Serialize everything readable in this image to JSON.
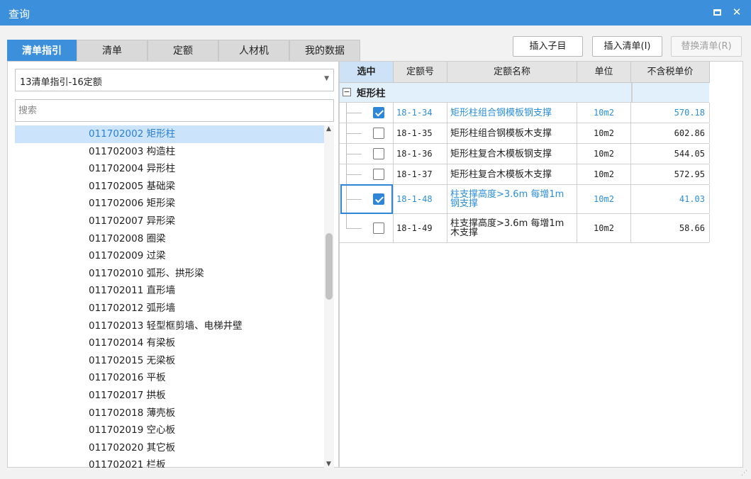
{
  "window": {
    "title": "查询"
  },
  "tabs": [
    {
      "label": "清单指引",
      "active": true
    },
    {
      "label": "清单",
      "active": false
    },
    {
      "label": "定额",
      "active": false
    },
    {
      "label": "人材机",
      "active": false
    },
    {
      "label": "我的数据",
      "active": false
    }
  ],
  "toolbar": {
    "insert_child_label": "插入子目",
    "insert_list_label": "插入清单(I)",
    "replace_list_label": "替换清单(R)"
  },
  "left": {
    "combo_value": "13清单指引-16定额",
    "search_placeholder": "搜索",
    "items": [
      {
        "label": "011702002  矩形柱",
        "selected": true
      },
      {
        "label": "011702003  构造柱"
      },
      {
        "label": "011702004  异形柱"
      },
      {
        "label": "011702005  基础梁"
      },
      {
        "label": "011702006  矩形梁"
      },
      {
        "label": "011702007  异形梁"
      },
      {
        "label": "011702008  圈梁"
      },
      {
        "label": "011702009  过梁"
      },
      {
        "label": "011702010  弧形、拱形梁"
      },
      {
        "label": "011702011  直形墙"
      },
      {
        "label": "011702012  弧形墙"
      },
      {
        "label": "011702013  轻型框剪墙、电梯井壁"
      },
      {
        "label": "011702014  有梁板"
      },
      {
        "label": "011702015  无梁板"
      },
      {
        "label": "011702016  平板"
      },
      {
        "label": "011702017  拱板"
      },
      {
        "label": "011702018  薄壳板"
      },
      {
        "label": "011702019  空心板"
      },
      {
        "label": "011702020  其它板"
      },
      {
        "label": "011702021  栏板"
      }
    ]
  },
  "grid": {
    "headers": [
      "选中",
      "定额号",
      "定额名称",
      "单位",
      "不含税单价"
    ],
    "group_label": "矩形柱",
    "rows": [
      {
        "checked": true,
        "code": "18-1-34",
        "name": "矩形柱组合钢模板钢支撑",
        "unit": "10m2",
        "price": "570.18",
        "highlight": true
      },
      {
        "checked": false,
        "code": "18-1-35",
        "name": "矩形柱组合钢模板木支撑",
        "unit": "10m2",
        "price": "602.86",
        "highlight": false
      },
      {
        "checked": false,
        "code": "18-1-36",
        "name": "矩形柱复合木模板钢支撑",
        "unit": "10m2",
        "price": "544.05",
        "highlight": false
      },
      {
        "checked": false,
        "code": "18-1-37",
        "name": "矩形柱复合木模板木支撑",
        "unit": "10m2",
        "price": "572.95",
        "highlight": false
      },
      {
        "checked": true,
        "code": "18-1-48",
        "name_line1": "柱支撑高度>3.6m 每增1m",
        "name_line2": "钢支撑",
        "unit": "10m2",
        "price": "41.03",
        "highlight": true
      },
      {
        "checked": false,
        "code": "18-1-49",
        "name_line1": "柱支撑高度>3.6m 每增1m",
        "name_line2": "木支撑",
        "unit": "10m2",
        "price": "58.66",
        "highlight": false
      }
    ]
  },
  "icons": {
    "maximize": "maximize-icon",
    "close": "close-icon",
    "dropdown": "chevron-down-icon",
    "collapse": "minus-box-icon",
    "check": "checkbox-icon"
  },
  "colors": {
    "accent": "#3b8fdb",
    "selection": "#cce4fb",
    "highlight_text": "#2b8fd8",
    "group_row": "#e2f0fc"
  }
}
